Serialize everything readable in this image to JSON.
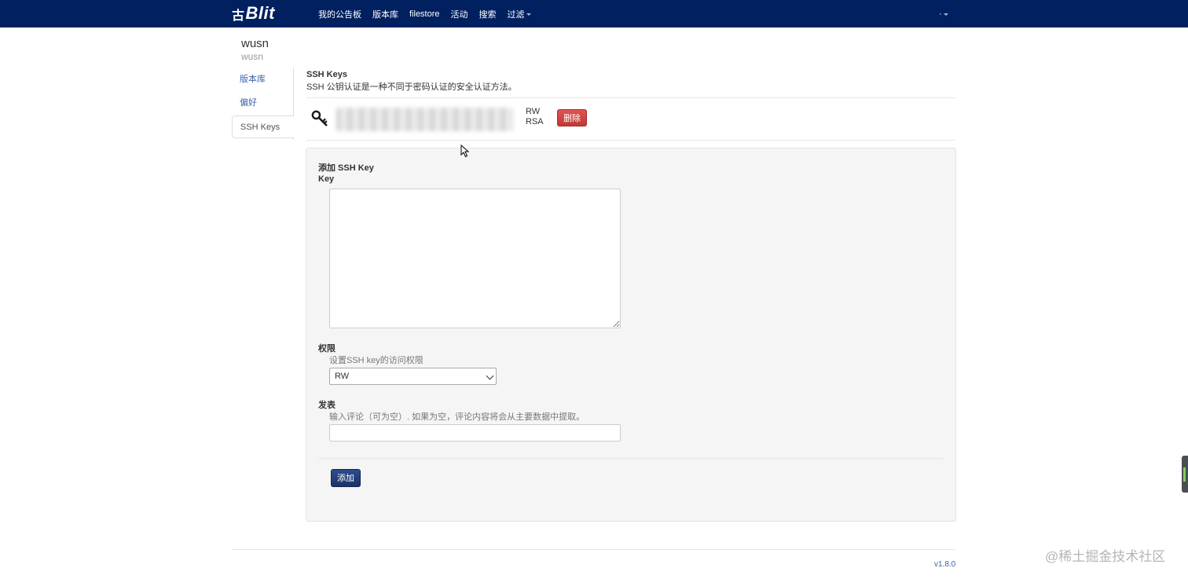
{
  "navbar": {
    "brand_mark": "古",
    "brand_text": "Blit",
    "links": [
      "我的公告板",
      "版本库",
      "filestore",
      "活动",
      "搜索",
      "过滤"
    ],
    "user_menu": "·"
  },
  "user": {
    "name": "wusn",
    "display_name": "wusn"
  },
  "side_tabs": {
    "repositories": "版本库",
    "preferences": "偏好",
    "ssh_keys": "SSH Keys"
  },
  "ssh_section": {
    "title": "SSH Keys",
    "description": "SSH 公钥认证是一种不同于密码认证的安全认证方法。"
  },
  "key_entry": {
    "permission": "RW",
    "algorithm": "RSA",
    "delete_label": "删除"
  },
  "add_form": {
    "legend": "添加 SSH Key",
    "key_label": "Key",
    "key_value": "",
    "permission_label": "权限",
    "permission_help": "设置SSH key的访问权限",
    "permission_selected": "RW",
    "comment_label": "发表",
    "comment_help": "输入评论（可为空）. 如果为空，评论内容将会从主要数据中提取。",
    "comment_value": "",
    "submit_label": "添加"
  },
  "footer": {
    "version": "v1.8.0",
    "watermark": "@稀土掘金技术社区"
  },
  "colors": {
    "navbar": "#002060",
    "link": "#3b63a8",
    "danger": "#c9302c",
    "primary": "#1f3a75"
  }
}
